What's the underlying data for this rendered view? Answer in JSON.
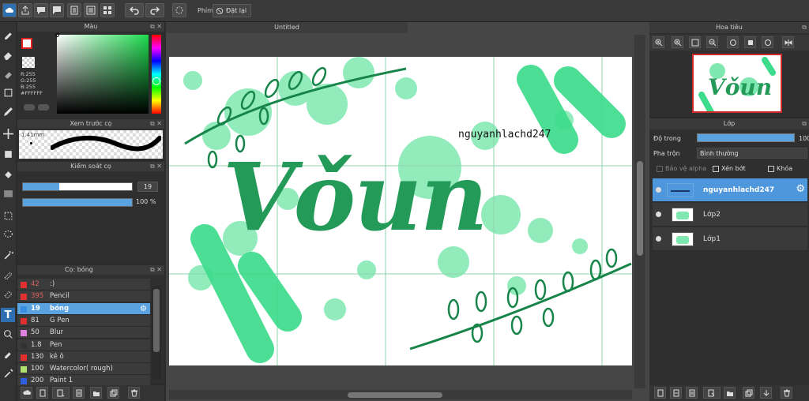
{
  "toolbar": {
    "filter_label": "Phím",
    "reset_label": "Đặt lại"
  },
  "canvas": {
    "tab_title": "Untitled",
    "artwork_word": "Vǒun",
    "artwork_caption": "nguyanhlachd247",
    "colors": {
      "accent": "#3ddc8c",
      "splash": "#7ee8b0",
      "ink": "#239a58",
      "leaf": "#17854a"
    }
  },
  "color_panel": {
    "title": "Màu",
    "r": "R:255",
    "g": "G:255",
    "b": "B:255",
    "hex": "#FFFFFF"
  },
  "brush_preview": {
    "title": "Xem trước cọ",
    "size": "1.41mm"
  },
  "brush_control": {
    "title": "Kiểm soát cọ",
    "size_value": "19",
    "size_fill": 0.33,
    "opacity_value": "100 %",
    "opacity_fill": 1.0
  },
  "brush_list": {
    "title": "Cọ: bóng",
    "items": [
      {
        "size": "42",
        "name": ":)",
        "color": "#e03030"
      },
      {
        "size": "395",
        "name": "Pencil",
        "color": "#e03030"
      },
      {
        "size": "19",
        "name": "bóng",
        "color": "#3a8ee0",
        "selected": true
      },
      {
        "size": "81",
        "name": "G Pen",
        "color": "#e03030"
      },
      {
        "size": "50",
        "name": "Blur",
        "color": "#e080e0"
      },
      {
        "size": "1.8",
        "name": "Pen",
        "color": "#333333"
      },
      {
        "size": "130",
        "name": "kê ô",
        "color": "#e03030"
      },
      {
        "size": "100",
        "name": "Watercolor( rough)",
        "color": "#b0e070"
      },
      {
        "size": "200",
        "name": "Paint 1",
        "color": "#3060e0"
      }
    ]
  },
  "navigator": {
    "title": "Hoa tiêu"
  },
  "layers": {
    "title": "Lớp",
    "opacity_label": "Độ trong",
    "opacity_value": "100",
    "blend_label": "Pha trộn",
    "blend_value": "Bình thường",
    "protect_alpha": "Bảo vệ alpha",
    "clipping": "Xén bớt",
    "lock": "Khóa",
    "items": [
      {
        "name": "nguyanhlachd247",
        "selected": true
      },
      {
        "name": "Lớp2",
        "selected": false
      },
      {
        "name": "Lớp1",
        "selected": false
      }
    ]
  }
}
